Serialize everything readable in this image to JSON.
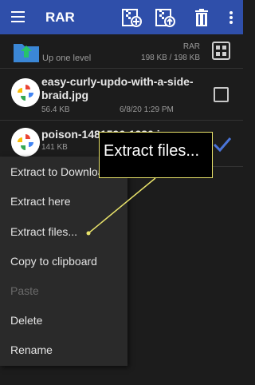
{
  "appbar": {
    "title": "RAR",
    "icons": [
      "menu-icon",
      "archive-add-icon",
      "archive-extract-icon",
      "trash-icon",
      "more-vert-icon"
    ]
  },
  "list": {
    "up": {
      "label": "Up one level",
      "type": "RAR",
      "size": "198 KB / 198 KB"
    },
    "files": [
      {
        "name": "easy-curly-updo-with-a-side-braid.jpg",
        "size": "56.4 KB",
        "date": "6/8/20 1:29 PM",
        "checked": false
      },
      {
        "name": "poison-1481596-1280.jpg",
        "size": "141 KB",
        "date": "",
        "checked": true
      }
    ]
  },
  "menu": {
    "items": [
      {
        "label": "Extract to Download",
        "enabled": true
      },
      {
        "label": "Extract here",
        "enabled": true
      },
      {
        "label": "Extract files...",
        "enabled": true
      },
      {
        "label": "Copy to clipboard",
        "enabled": true
      },
      {
        "label": "Paste",
        "enabled": false
      },
      {
        "label": "Delete",
        "enabled": true
      },
      {
        "label": "Rename",
        "enabled": true
      }
    ]
  },
  "tooltip": {
    "text": "Extract files..."
  },
  "colors": {
    "appbar": "#2f4faa",
    "background": "#1c1c1c",
    "accent": "#4a74d8",
    "callout": "#e8e26a"
  }
}
